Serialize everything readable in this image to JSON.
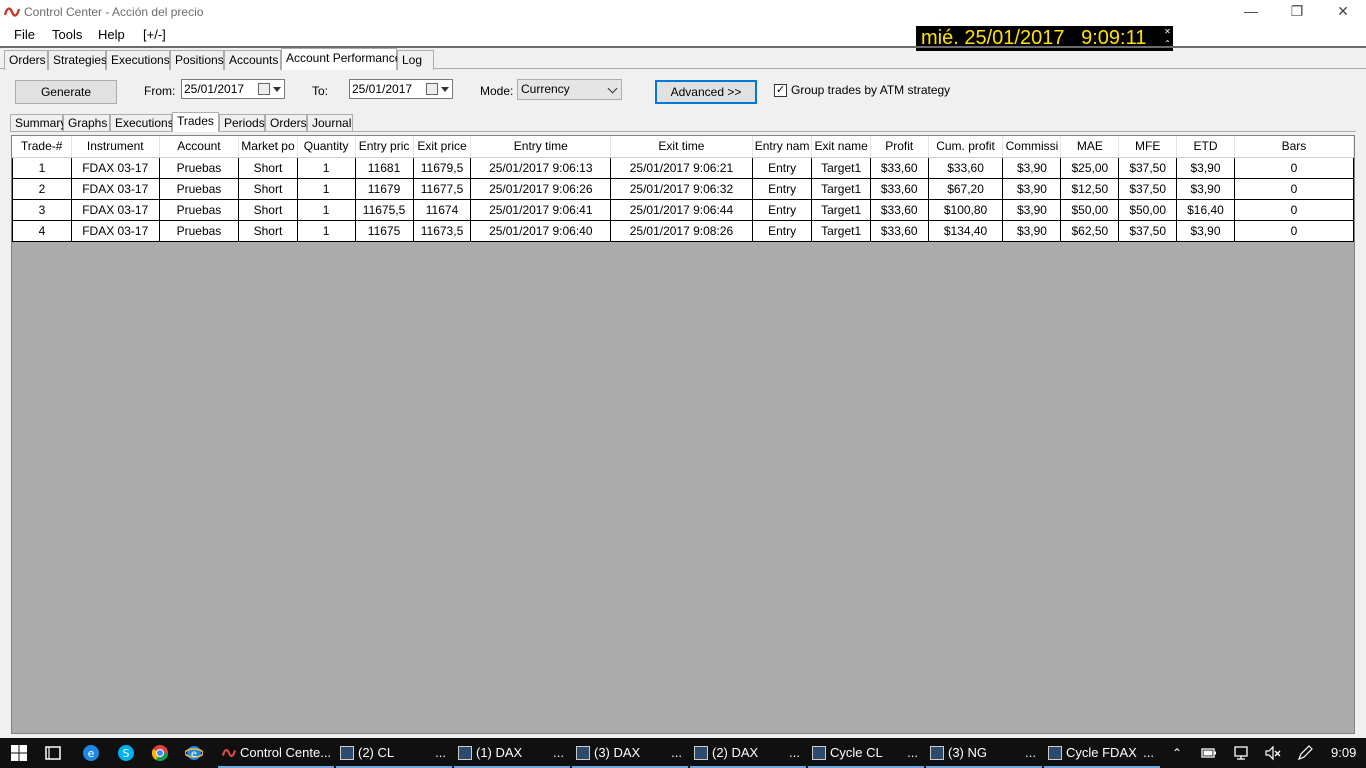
{
  "window": {
    "title": "Control Center - Acción del precio",
    "minimize": "—",
    "maximize": "❐",
    "close": "✕"
  },
  "menu": [
    "File",
    "Tools",
    "Help",
    "[+/-]"
  ],
  "clock": {
    "text": "mié. 25/01/2017   9:09:11",
    "close": "✕",
    "expand": "⌃"
  },
  "main_tabs": [
    "Orders",
    "Strategies",
    "Executions",
    "Positions",
    "Accounts",
    "Account Performance",
    "Log"
  ],
  "toolbar": {
    "generate_label": "Generate",
    "from_label": "From:",
    "from_value": "25/01/2017",
    "to_label": "To:",
    "to_value": "25/01/2017",
    "mode_label": "Mode:",
    "mode_value": "Currency",
    "advanced_label": "Advanced >>",
    "group_checked": "✓",
    "group_label": "Group trades by ATM strategy"
  },
  "sub_tabs": [
    "Summary",
    "Graphs",
    "Executions",
    "Trades",
    "Periods",
    "Orders",
    "Journal"
  ],
  "table": {
    "columns": [
      "Trade-#",
      "Instrument",
      "Account",
      "Market po",
      "Quantity",
      "Entry pric",
      "Exit price",
      "Entry time",
      "Exit time",
      "Entry nam",
      "Exit name",
      "Profit",
      "Cum. profit",
      "Commissi",
      "MAE",
      "MFE",
      "ETD",
      "Bars"
    ],
    "rows": [
      [
        "1",
        "FDAX 03-17",
        "Pruebas",
        "Short",
        "1",
        "11681",
        "11679,5",
        "25/01/2017 9:06:13",
        "25/01/2017 9:06:21",
        "Entry",
        "Target1",
        "$33,60",
        "$33,60",
        "$3,90",
        "$25,00",
        "$37,50",
        "$3,90",
        "0"
      ],
      [
        "2",
        "FDAX 03-17",
        "Pruebas",
        "Short",
        "1",
        "11679",
        "11677,5",
        "25/01/2017 9:06:26",
        "25/01/2017 9:06:32",
        "Entry",
        "Target1",
        "$33,60",
        "$67,20",
        "$3,90",
        "$12,50",
        "$37,50",
        "$3,90",
        "0"
      ],
      [
        "3",
        "FDAX 03-17",
        "Pruebas",
        "Short",
        "1",
        "11675,5",
        "11674",
        "25/01/2017 9:06:41",
        "25/01/2017 9:06:44",
        "Entry",
        "Target1",
        "$33,60",
        "$100,80",
        "$3,90",
        "$50,00",
        "$50,00",
        "$16,40",
        "0"
      ],
      [
        "4",
        "FDAX 03-17",
        "Pruebas",
        "Short",
        "1",
        "11675",
        "11673,5",
        "25/01/2017 9:06:40",
        "25/01/2017 9:08:26",
        "Entry",
        "Target1",
        "$33,60",
        "$134,40",
        "$3,90",
        "$62,50",
        "$37,50",
        "$3,90",
        "0"
      ]
    ]
  },
  "taskbar": {
    "apps": [
      {
        "label": "Control Cente...",
        "dots": ""
      },
      {
        "label": "(2) CL",
        "dots": "..."
      },
      {
        "label": "(1) DAX",
        "dots": "..."
      },
      {
        "label": "(3) DAX",
        "dots": "..."
      },
      {
        "label": "(2) DAX",
        "dots": "..."
      },
      {
        "label": "Cycle CL",
        "dots": "..."
      },
      {
        "label": "(3) NG",
        "dots": "..."
      },
      {
        "label": "Cycle FDAX",
        "dots": "..."
      }
    ],
    "time": "9:09"
  },
  "colors": {
    "clock_bg": "#000000",
    "clock_fg": "#ffe000",
    "grid_bg": "#ababab",
    "taskbar_bg": "#101010",
    "accent": "#0078d7"
  }
}
